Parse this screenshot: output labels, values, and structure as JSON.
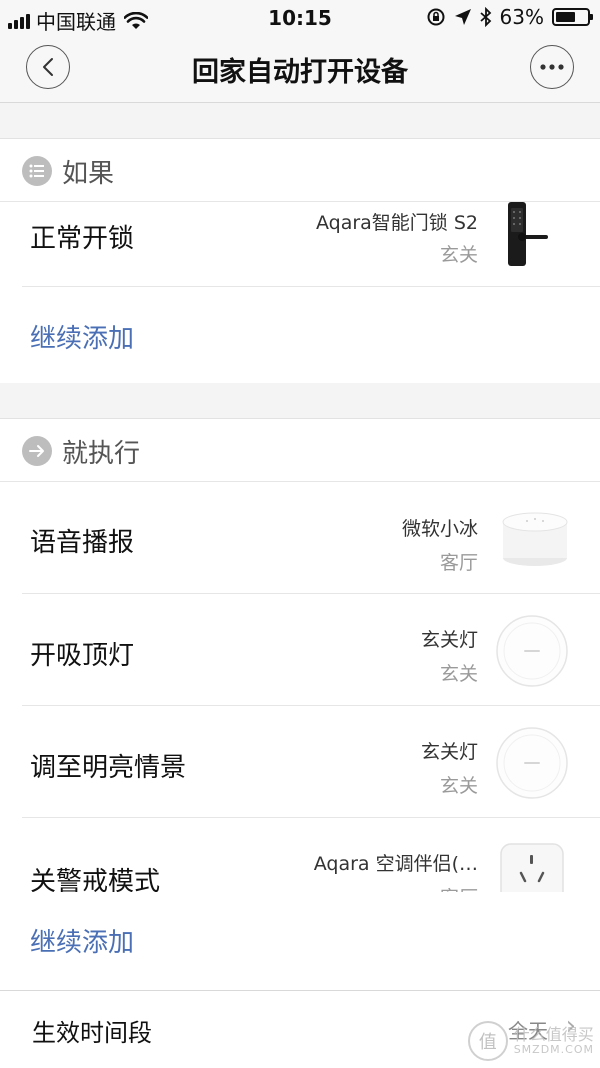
{
  "status_bar": {
    "carrier": "中国联通",
    "time": "10:15",
    "battery": "63%",
    "battery_level": 0.63,
    "icons": [
      "signal-icon",
      "wifi-icon",
      "rotation-lock-icon",
      "location-icon",
      "bluetooth-icon",
      "battery-icon"
    ]
  },
  "nav": {
    "title": "回家自动打开设备",
    "back_icon": "chevron-left-icon",
    "more_icon": "more-dots-icon"
  },
  "if_section": {
    "title": "如果",
    "icon": "list-icon",
    "items": [
      {
        "label": "正常开锁",
        "device": "Aqara智能门锁 S2",
        "room": "玄关",
        "thumb": "door-lock-thumbnail"
      }
    ],
    "add_label": "继续添加"
  },
  "then_section": {
    "title": "就执行",
    "icon": "arrow-right-icon",
    "items": [
      {
        "label": "语音播报",
        "device": "微软小冰",
        "room": "客厅",
        "thumb": "speaker-thumbnail"
      },
      {
        "label": "开吸顶灯",
        "device": "玄关灯",
        "room": "玄关",
        "thumb": "ceiling-light-thumbnail"
      },
      {
        "label": "调至明亮情景",
        "device": "玄关灯",
        "room": "玄关",
        "thumb": "ceiling-light-thumbnail"
      },
      {
        "label": "关警戒模式",
        "device": "Aqara 空调伴侣(…",
        "room": "客厅",
        "thumb": "ac-companion-thumbnail"
      }
    ],
    "add_label": "继续添加"
  },
  "footer": {
    "label": "生效时间段",
    "value": "全天"
  },
  "watermark": {
    "line1": "什么值得买",
    "line2": "SMZDM.COM",
    "badge": "值"
  },
  "colors": {
    "link": "#4a6fb5",
    "nav_bg": "#f7f7f7",
    "section_icon": "#bdbdbd"
  }
}
